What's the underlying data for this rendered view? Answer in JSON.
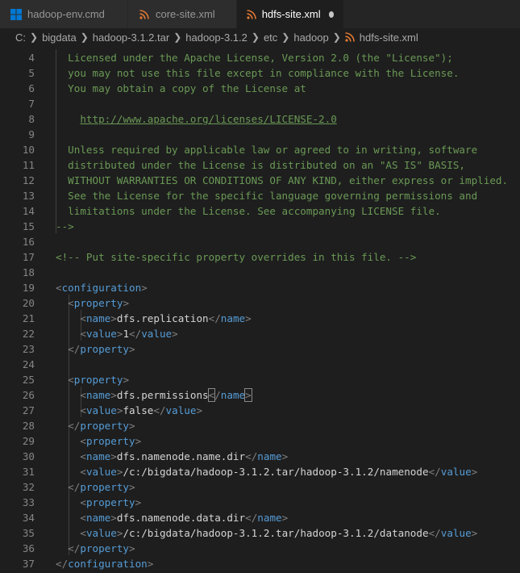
{
  "tabs": [
    {
      "label": "hadoop-env.cmd",
      "icon": "windows-icon",
      "active": false
    },
    {
      "label": "core-site.xml",
      "icon": "rss-icon",
      "active": false
    },
    {
      "label": "hdfs-site.xml",
      "icon": "rss-icon",
      "active": true,
      "modified": true
    }
  ],
  "breadcrumb": [
    "C:",
    "bigdata",
    "hadoop-3.1.2.tar",
    "hadoop-3.1.2",
    "etc",
    "hadoop",
    "hdfs-site.xml"
  ],
  "colors": {
    "comment": "#6a9955",
    "tag": "#569cd6",
    "bracket": "#808080",
    "text": "#d4d4d4",
    "line_number": "#858585",
    "xml_icon": "#e37933",
    "windows_icon": "#0078d4"
  },
  "lines": [
    {
      "n": "4",
      "parts": [
        {
          "t": "  Licensed under the Apache License, Version 2.0 (the \"License\");",
          "c": "comment"
        }
      ]
    },
    {
      "n": "5",
      "parts": [
        {
          "t": "  you may not use this file except in compliance with the License.",
          "c": "comment"
        }
      ]
    },
    {
      "n": "6",
      "parts": [
        {
          "t": "  You may obtain a copy of the License at",
          "c": "comment"
        }
      ]
    },
    {
      "n": "7",
      "parts": []
    },
    {
      "n": "8",
      "parts": [
        {
          "t": "    ",
          "c": "comment"
        },
        {
          "t": "http://www.apache.org/licenses/LICENSE-2.0",
          "c": "link"
        }
      ]
    },
    {
      "n": "9",
      "parts": []
    },
    {
      "n": "10",
      "parts": [
        {
          "t": "  Unless required by applicable law or agreed to in writing, software",
          "c": "comment"
        }
      ]
    },
    {
      "n": "11",
      "parts": [
        {
          "t": "  distributed under the License is distributed on an \"AS IS\" BASIS,",
          "c": "comment"
        }
      ]
    },
    {
      "n": "12",
      "parts": [
        {
          "t": "  WITHOUT WARRANTIES OR CONDITIONS OF ANY KIND, either express or implied.",
          "c": "comment"
        }
      ]
    },
    {
      "n": "13",
      "parts": [
        {
          "t": "  See the License for the specific language governing permissions and",
          "c": "comment"
        }
      ]
    },
    {
      "n": "14",
      "parts": [
        {
          "t": "  limitations under the License. See accompanying LICENSE file.",
          "c": "comment"
        }
      ]
    },
    {
      "n": "15",
      "parts": [
        {
          "t": "-->",
          "c": "comment"
        }
      ]
    },
    {
      "n": "16",
      "parts": []
    },
    {
      "n": "17",
      "parts": [
        {
          "t": "<!-- Put site-specific property overrides in this file. -->",
          "c": "comment"
        }
      ]
    },
    {
      "n": "18",
      "parts": []
    },
    {
      "n": "19",
      "parts": [
        {
          "t": "<",
          "c": "bracket"
        },
        {
          "t": "configuration",
          "c": "tag"
        },
        {
          "t": ">",
          "c": "bracket"
        }
      ]
    },
    {
      "n": "20",
      "parts": [
        {
          "t": "  ",
          "c": "text"
        },
        {
          "t": "<",
          "c": "bracket"
        },
        {
          "t": "property",
          "c": "tag"
        },
        {
          "t": ">",
          "c": "bracket"
        }
      ]
    },
    {
      "n": "21",
      "parts": [
        {
          "t": "    ",
          "c": "text"
        },
        {
          "t": "<",
          "c": "bracket"
        },
        {
          "t": "name",
          "c": "tag"
        },
        {
          "t": ">",
          "c": "bracket"
        },
        {
          "t": "dfs.replication",
          "c": "text"
        },
        {
          "t": "</",
          "c": "bracket"
        },
        {
          "t": "name",
          "c": "tag"
        },
        {
          "t": ">",
          "c": "bracket"
        }
      ]
    },
    {
      "n": "22",
      "parts": [
        {
          "t": "    ",
          "c": "text"
        },
        {
          "t": "<",
          "c": "bracket"
        },
        {
          "t": "value",
          "c": "tag"
        },
        {
          "t": ">",
          "c": "bracket"
        },
        {
          "t": "1",
          "c": "text"
        },
        {
          "t": "</",
          "c": "bracket"
        },
        {
          "t": "value",
          "c": "tag"
        },
        {
          "t": ">",
          "c": "bracket"
        }
      ]
    },
    {
      "n": "23",
      "parts": [
        {
          "t": "  ",
          "c": "text"
        },
        {
          "t": "</",
          "c": "bracket"
        },
        {
          "t": "property",
          "c": "tag"
        },
        {
          "t": ">",
          "c": "bracket"
        }
      ]
    },
    {
      "n": "24",
      "parts": []
    },
    {
      "n": "25",
      "parts": [
        {
          "t": "  ",
          "c": "text"
        },
        {
          "t": "<",
          "c": "bracket"
        },
        {
          "t": "property",
          "c": "tag"
        },
        {
          "t": ">",
          "c": "bracket"
        }
      ]
    },
    {
      "n": "26",
      "parts": [
        {
          "t": "    ",
          "c": "text"
        },
        {
          "t": "<",
          "c": "bracket"
        },
        {
          "t": "name",
          "c": "tag"
        },
        {
          "t": ">",
          "c": "bracket"
        },
        {
          "t": "dfs.permissions",
          "c": "text"
        },
        {
          "t": "<",
          "c": "bracket",
          "hl": true
        },
        {
          "t": "/",
          "c": "bracket"
        },
        {
          "t": "name",
          "c": "tag"
        },
        {
          "t": ">",
          "c": "bracket",
          "hl": true
        }
      ]
    },
    {
      "n": "27",
      "parts": [
        {
          "t": "    ",
          "c": "text"
        },
        {
          "t": "<",
          "c": "bracket"
        },
        {
          "t": "value",
          "c": "tag"
        },
        {
          "t": ">",
          "c": "bracket"
        },
        {
          "t": "false",
          "c": "text"
        },
        {
          "t": "</",
          "c": "bracket"
        },
        {
          "t": "value",
          "c": "tag"
        },
        {
          "t": ">",
          "c": "bracket"
        }
      ]
    },
    {
      "n": "28",
      "parts": [
        {
          "t": "  ",
          "c": "text"
        },
        {
          "t": "</",
          "c": "bracket"
        },
        {
          "t": "property",
          "c": "tag"
        },
        {
          "t": ">",
          "c": "bracket"
        }
      ]
    },
    {
      "n": "29",
      "parts": [
        {
          "t": "    ",
          "c": "text"
        },
        {
          "t": "<",
          "c": "bracket"
        },
        {
          "t": "property",
          "c": "tag"
        },
        {
          "t": ">",
          "c": "bracket"
        }
      ]
    },
    {
      "n": "30",
      "parts": [
        {
          "t": "    ",
          "c": "text"
        },
        {
          "t": "<",
          "c": "bracket"
        },
        {
          "t": "name",
          "c": "tag"
        },
        {
          "t": ">",
          "c": "bracket"
        },
        {
          "t": "dfs.namenode.name.dir",
          "c": "text"
        },
        {
          "t": "</",
          "c": "bracket"
        },
        {
          "t": "name",
          "c": "tag"
        },
        {
          "t": ">",
          "c": "bracket"
        }
      ]
    },
    {
      "n": "31",
      "parts": [
        {
          "t": "    ",
          "c": "text"
        },
        {
          "t": "<",
          "c": "bracket"
        },
        {
          "t": "value",
          "c": "tag"
        },
        {
          "t": ">",
          "c": "bracket"
        },
        {
          "t": "/c:/bigdata/hadoop-3.1.2.tar/hadoop-3.1.2/namenode",
          "c": "text"
        },
        {
          "t": "</",
          "c": "bracket"
        },
        {
          "t": "value",
          "c": "tag"
        },
        {
          "t": ">",
          "c": "bracket"
        }
      ]
    },
    {
      "n": "32",
      "parts": [
        {
          "t": "  ",
          "c": "text"
        },
        {
          "t": "</",
          "c": "bracket"
        },
        {
          "t": "property",
          "c": "tag"
        },
        {
          "t": ">",
          "c": "bracket"
        }
      ]
    },
    {
      "n": "33",
      "parts": [
        {
          "t": "    ",
          "c": "text"
        },
        {
          "t": "<",
          "c": "bracket"
        },
        {
          "t": "property",
          "c": "tag"
        },
        {
          "t": ">",
          "c": "bracket"
        }
      ]
    },
    {
      "n": "34",
      "parts": [
        {
          "t": "    ",
          "c": "text"
        },
        {
          "t": "<",
          "c": "bracket"
        },
        {
          "t": "name",
          "c": "tag"
        },
        {
          "t": ">",
          "c": "bracket"
        },
        {
          "t": "dfs.namenode.data.dir",
          "c": "text"
        },
        {
          "t": "</",
          "c": "bracket"
        },
        {
          "t": "name",
          "c": "tag"
        },
        {
          "t": ">",
          "c": "bracket"
        }
      ]
    },
    {
      "n": "35",
      "parts": [
        {
          "t": "    ",
          "c": "text"
        },
        {
          "t": "<",
          "c": "bracket"
        },
        {
          "t": "value",
          "c": "tag"
        },
        {
          "t": ">",
          "c": "bracket"
        },
        {
          "t": "/c:/bigdata/hadoop-3.1.2.tar/hadoop-3.1.2/datanode",
          "c": "text"
        },
        {
          "t": "</",
          "c": "bracket"
        },
        {
          "t": "value",
          "c": "tag"
        },
        {
          "t": ">",
          "c": "bracket"
        }
      ]
    },
    {
      "n": "36",
      "parts": [
        {
          "t": "  ",
          "c": "text"
        },
        {
          "t": "</",
          "c": "bracket"
        },
        {
          "t": "property",
          "c": "tag"
        },
        {
          "t": ">",
          "c": "bracket"
        }
      ]
    },
    {
      "n": "37",
      "parts": [
        {
          "t": "</",
          "c": "bracket"
        },
        {
          "t": "configuration",
          "c": "tag"
        },
        {
          "t": ">",
          "c": "bracket"
        }
      ]
    }
  ]
}
